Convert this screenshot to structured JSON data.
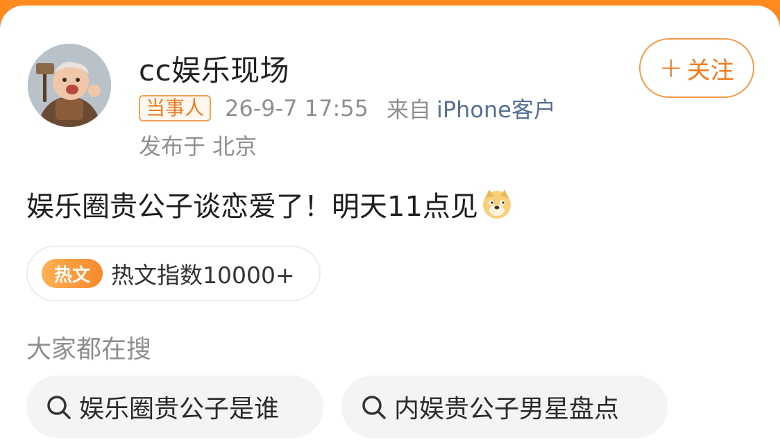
{
  "post": {
    "username": "cc娱乐现场",
    "follow_label": "关注",
    "badge": "当事人",
    "time": "26-9-7 17:55",
    "from_label": "来自",
    "device": "iPhone客户",
    "location": "发布于 北京",
    "text": "娱乐圈贵公子谈恋爱了！明天11点见",
    "emoji": "doge-emoji"
  },
  "hot": {
    "tag": "热文",
    "text": "热文指数10000+"
  },
  "search": {
    "title": "大家都在搜",
    "items": [
      {
        "label": "娱乐圈贵公子是谁"
      },
      {
        "label": "内娱贵公子男星盘点"
      }
    ]
  },
  "colors": {
    "accent": "#f07b1f",
    "link": "#566f93",
    "muted": "#8f8f8f",
    "top_bar": "#ff8a1e"
  }
}
